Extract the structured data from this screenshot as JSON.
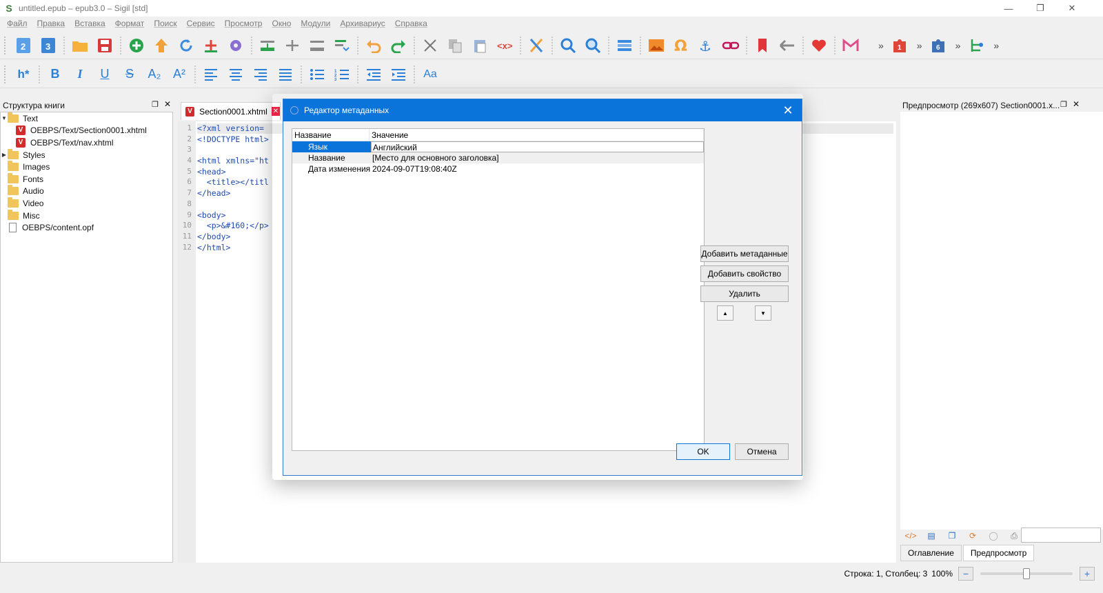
{
  "window": {
    "title": "untitled.epub – epub3.0 – Sigil [std]",
    "app_icon": "S"
  },
  "menu": [
    "Файл",
    "Правка",
    "Вставка",
    "Формат",
    "Поиск",
    "Сервис",
    "Просмотр",
    "Окно",
    "Модули",
    "Архивариус",
    "Справка"
  ],
  "toolbar1": {
    "icons": [
      "epub2-icon",
      "epub3-icon",
      "open-folder-icon",
      "save-icon",
      "add-file-icon",
      "upload-icon",
      "reload-icon",
      "add-existing-icon",
      "settings-icon",
      "insert-before-icon",
      "split-icon",
      "merge-icon",
      "toc-icon",
      "undo-icon",
      "redo-icon",
      "cut-icon",
      "copy-icon",
      "paste-icon",
      "code-tag-icon",
      "clean-icon",
      "find-icon",
      "find-replace-icon",
      "metadata-icon",
      "image-icon",
      "omega-icon",
      "anchor-icon",
      "link-icon",
      "bookmark-icon",
      "back-arrow-icon",
      "heart-icon",
      "gmail-icon",
      "plugin-red-icon",
      "plugin-blue-icon",
      "tree-icon"
    ],
    "badge_red": "1",
    "badge_blue": "6",
    "more_glyph": "»"
  },
  "toolbar2": {
    "heading_label": "h*",
    "bold": "B",
    "italic": "I",
    "underline": "U",
    "strike": "S",
    "subscript": "A₂",
    "superscript": "A²",
    "case": "Aa"
  },
  "book_browser": {
    "title": "Структура книги",
    "items": [
      {
        "label": "Text",
        "type": "folder",
        "expanded": true
      },
      {
        "label": "OEBPS/Text/Section0001.xhtml",
        "type": "xhtml"
      },
      {
        "label": "OEBPS/Text/nav.xhtml",
        "type": "xhtml"
      },
      {
        "label": "Styles",
        "type": "folder"
      },
      {
        "label": "Images",
        "type": "folder"
      },
      {
        "label": "Fonts",
        "type": "folder"
      },
      {
        "label": "Audio",
        "type": "folder"
      },
      {
        "label": "Video",
        "type": "folder"
      },
      {
        "label": "Misc",
        "type": "folder"
      },
      {
        "label": "OEBPS/content.opf",
        "type": "file"
      }
    ]
  },
  "editor": {
    "tab_label": "Section0001.xhtml",
    "lines": [
      "<?xml version=",
      "<!DOCTYPE html>",
      "",
      "<html xmlns=\"ht",
      "<head>",
      "  <title></titl",
      "</head>",
      "",
      "<body>",
      "  <p>&#160;</p>",
      "</body>",
      "</html>"
    ],
    "line_numbers": [
      "1",
      "2",
      "3",
      "4",
      "5",
      "6",
      "7",
      "8",
      "9",
      "10",
      "11",
      "12"
    ]
  },
  "preview": {
    "title": "Предпросмотр (269x607) Section0001.x...",
    "tabs": [
      "Оглавление",
      "Предпросмотр"
    ],
    "active_tab": 1
  },
  "status": {
    "position": "Строка: 1, Столбец: 3",
    "zoom": "100%",
    "zoom_fraction": 0.5
  },
  "dialog": {
    "title": "Редактор метаданных",
    "columns": [
      "Название",
      "Значение"
    ],
    "rows": [
      {
        "name": "Язык",
        "value": "Английский",
        "selected": true
      },
      {
        "name": "Название",
        "value": "[Место для основного заголовка]"
      },
      {
        "name": "Дата изменения",
        "value": "2024-09-07T19:08:40Z"
      }
    ],
    "buttons": {
      "add_metadata": "Добавить метаданные",
      "add_property": "Добавить свойство",
      "delete": "Удалить",
      "ok": "OK",
      "cancel": "Отмена"
    }
  },
  "colors": {
    "accent": "#0a74da",
    "selection": "#0a74da"
  }
}
